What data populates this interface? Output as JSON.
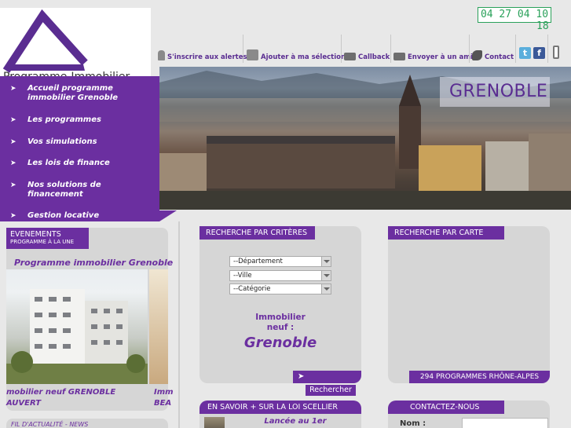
{
  "header": {
    "logo_text": "Programme-Immobilier",
    "phone": "04 27 04 10",
    "phone_ext": "18",
    "toolbar": [
      {
        "label": "S'inscrire aux alertes",
        "icon": "pin-icon"
      },
      {
        "label": "Ajouter à ma sélection",
        "icon": "basket-icon"
      },
      {
        "label": "Callback",
        "icon": "keyboard-icon"
      },
      {
        "label": "Envoyer à un ami",
        "icon": "card-icon"
      },
      {
        "label": "Contact",
        "icon": "phone-icon"
      }
    ],
    "social": [
      {
        "name": "twitter",
        "letter": "t",
        "color": "#5aaedc"
      },
      {
        "name": "facebook",
        "letter": "f",
        "color": "#3b5998"
      }
    ]
  },
  "menu": {
    "items": [
      {
        "label": "Accueil programme immobilier Grenoble"
      },
      {
        "label": "Les programmes"
      },
      {
        "label": "Vos simulations"
      },
      {
        "label": "Les lois de finance"
      },
      {
        "label": "Nos solutions de financement"
      },
      {
        "label": "Gestion locative"
      }
    ]
  },
  "banner": {
    "city": "GRENOBLE"
  },
  "events": {
    "title": "EVENEMENTS",
    "subtitle": "PROGRAMME À LA UNE",
    "caption": "Programme immobilier Grenoble",
    "item_title_1a": "mobilier neuf GRENOBLE",
    "item_title_1b": "AUVERT",
    "item_title_2a": "Imm",
    "item_title_2b": "BEA"
  },
  "news": {
    "label": "FIL D'ACTUALITÉ - NEWS"
  },
  "criteria": {
    "title": "RECHERCHE PAR CRITÈRES",
    "departement": "--Département",
    "ville": "--Ville",
    "categorie": "--Catégorie",
    "immo_label": "Immobilier neuf :",
    "city": "Grenoble",
    "search_button": "Rechercher"
  },
  "map": {
    "title": "RECHERCHE PAR CARTE",
    "count": "294 PROGRAMMES RHÔNE-ALPES"
  },
  "scellier": {
    "title": "EN SAVOIR + SUR LA LOI SCELLIER",
    "text": "Lancée au 1er"
  },
  "contact": {
    "title": "CONTACTEZ-NOUS",
    "nom_label": "Nom :"
  },
  "colors": {
    "accent": "#6b2fa0",
    "phone": "#2aa15a",
    "panel": "#d6d6d6"
  }
}
